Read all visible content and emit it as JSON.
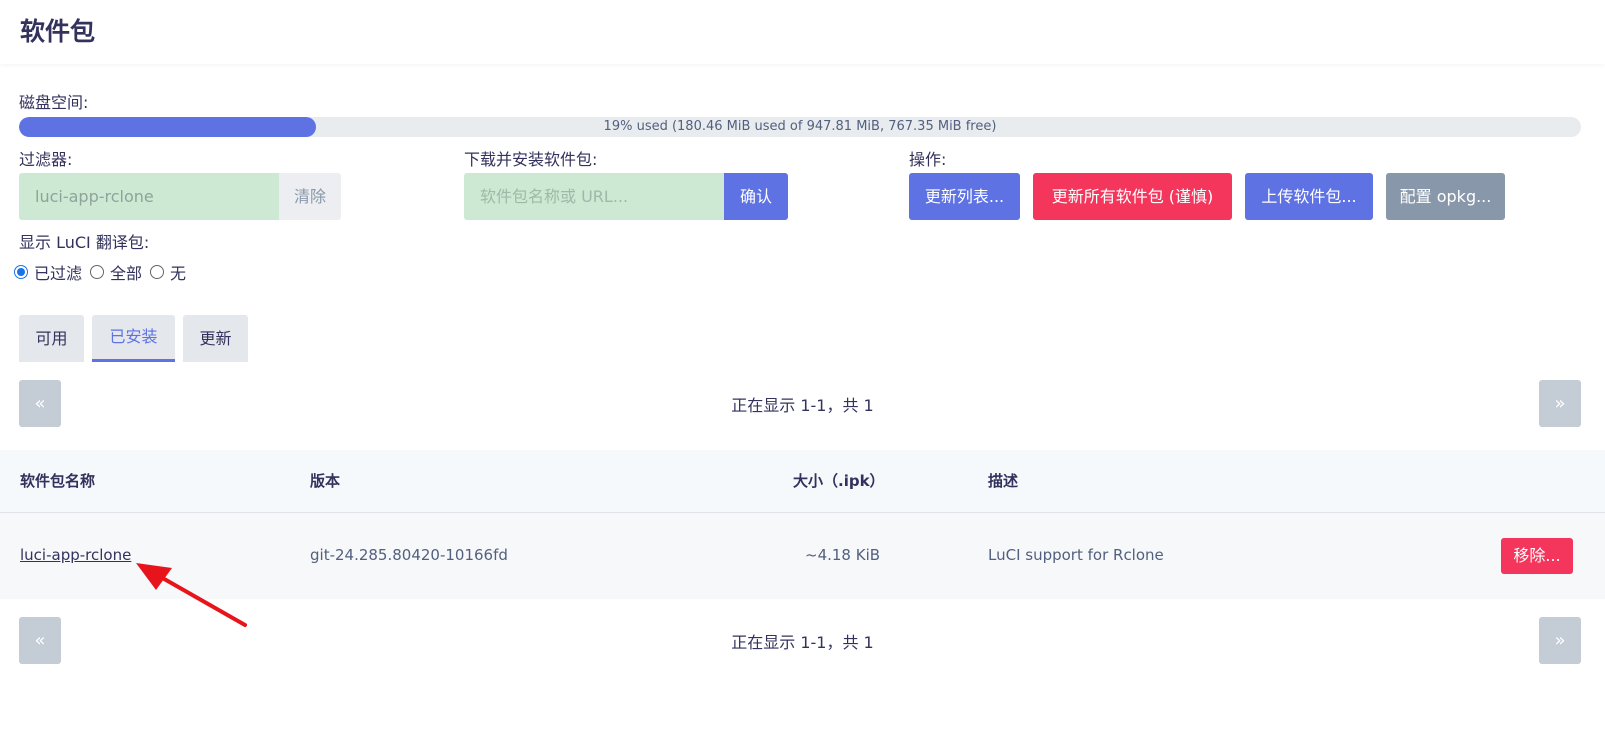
{
  "page": {
    "title": "软件包"
  },
  "disk": {
    "label": "磁盘空间:",
    "used_percent": 19,
    "text": "19% used (180.46 MiB used of 947.81 MiB, 767.35 MiB free)",
    "color": "#5e72e4"
  },
  "filter": {
    "label": "过滤器:",
    "value": "luci-app-rclone",
    "clear_label": "清除"
  },
  "download": {
    "label": "下载并安装软件包:",
    "placeholder": "软件包名称或 URL...",
    "confirm_label": "确认"
  },
  "actions": {
    "label": "操作:",
    "update_lists": "更新列表...",
    "upgrade_all": "更新所有软件包 (谨慎)",
    "upload": "上传软件包...",
    "configure": "配置 opkg..."
  },
  "translations": {
    "label": "显示 LuCI 翻译包:",
    "options": [
      "已过滤",
      "全部",
      "无"
    ],
    "selected": "已过滤"
  },
  "tabs": [
    {
      "label": "可用",
      "active": false
    },
    {
      "label": "已安装",
      "active": true
    },
    {
      "label": "更新",
      "active": false
    }
  ],
  "pager": {
    "prev": "«",
    "next": "»",
    "status": "正在显示 1-1，共 1"
  },
  "table": {
    "headers": [
      "软件包名称",
      "版本",
      "大小（.ipk）",
      "描述"
    ],
    "rows": [
      {
        "name": "luci-app-rclone",
        "version": "git-24.285.80420-10166fd",
        "size": "~4.18 KiB",
        "description": "LuCI support for Rclone",
        "action": "移除..."
      }
    ]
  },
  "colors": {
    "primary": "#5e72e4",
    "danger": "#f5365c",
    "secondary": "#8898aa",
    "annotation": "#e8141c"
  }
}
